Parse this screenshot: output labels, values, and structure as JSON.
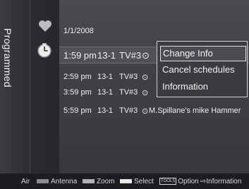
{
  "sidebar": {
    "title": "Programmed"
  },
  "icons": {
    "favorite": "heart-icon",
    "schedule": "clock-icon",
    "timer": "timer-icon"
  },
  "schedule": {
    "date": "1/1/2008",
    "rows": [
      {
        "time": "1:59 pm",
        "channel": "13-1",
        "name": "TV#3",
        "program": ""
      },
      {
        "time": "2:59 pm",
        "channel": "13-1",
        "name": "TV#3",
        "program": ""
      },
      {
        "time": "3:59 pm",
        "channel": "13-1",
        "name": "TV#3",
        "program": ""
      },
      {
        "time": "5:59 pm",
        "channel": "13-1",
        "name": "TV#3",
        "program": "M.Spillane's mike Hammer"
      }
    ]
  },
  "popup": {
    "items": [
      "Change Info",
      "Cancel schedules",
      "Information"
    ],
    "focused_index": 0
  },
  "footer": {
    "source": "Air",
    "antenna": "Antenna",
    "zoom": "Zoom",
    "select": "Select",
    "tools": "TOOLS",
    "option": "Option",
    "information": "Information"
  },
  "colors": {
    "antenna_key": "#8a8c90",
    "zoom_key": "#b0b2b5",
    "select_key": "#e8e8e8",
    "popup_border": "#d0d0d0"
  }
}
